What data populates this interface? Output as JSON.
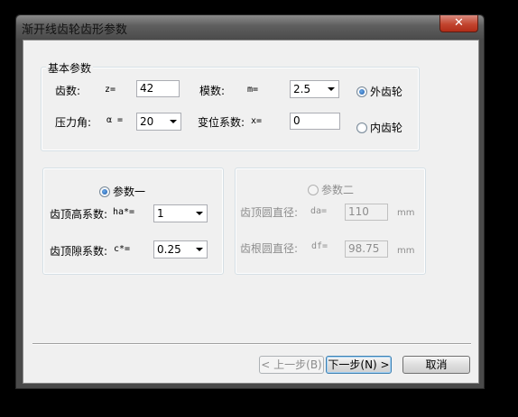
{
  "window": {
    "title": "渐开线齿轮齿形参数",
    "close_label": "✕"
  },
  "basic": {
    "group_title": "基本参数",
    "teeth": {
      "label": "齿数:",
      "symbol": "z=",
      "value": "42"
    },
    "module": {
      "label": "模数:",
      "symbol": "m=",
      "value": "2.5"
    },
    "pressure_angle": {
      "label": "压力角:",
      "symbol": "α =",
      "value": "20"
    },
    "shift": {
      "label": "变位系数:",
      "symbol": "x=",
      "value": "0"
    },
    "external_gear": {
      "label": "外齿轮",
      "checked": true
    },
    "internal_gear": {
      "label": "内齿轮",
      "checked": false
    }
  },
  "param1": {
    "radio_label": "参数一",
    "checked": true,
    "addendum": {
      "label": "齿顶高系数:",
      "symbol": "ha*=",
      "value": "1"
    },
    "clearance": {
      "label": "齿顶隙系数:",
      "symbol": "c*=",
      "value": "0.25"
    }
  },
  "param2": {
    "radio_label": "参数二",
    "checked": false,
    "tip_diameter": {
      "label": "齿顶圆直径:",
      "symbol": "da=",
      "value": "110",
      "unit": "mm"
    },
    "root_diameter": {
      "label": "齿根圆直径:",
      "symbol": "df=",
      "value": "98.75",
      "unit": "mm"
    }
  },
  "buttons": {
    "prev": "< 上一步(B)",
    "next": "下一步(N) >",
    "cancel": "取消"
  }
}
